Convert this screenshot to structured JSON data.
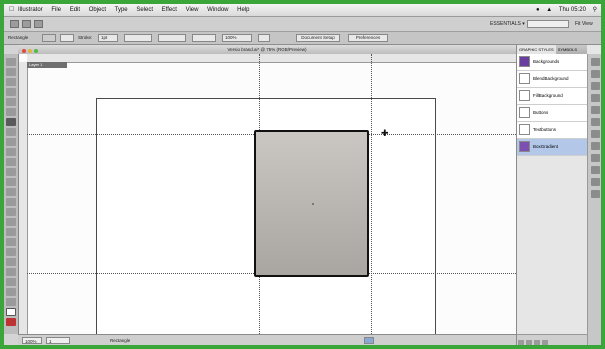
{
  "menubar": {
    "apple_icon": "apple-icon",
    "items": [
      "Illustrator",
      "File",
      "Edit",
      "Object",
      "Type",
      "Select",
      "Effect",
      "View",
      "Window",
      "Help"
    ],
    "clock": "Thu 05:20"
  },
  "appbar": {
    "workspace": "ESSENTIALS ▾",
    "zoom": "Fit View"
  },
  "controlbar": {
    "mode": "Rectangle",
    "stroke": "Stroke:",
    "stroke_value": "1pt",
    "opacity": "100%",
    "document_setup": "Document Setup",
    "preferences": "Preferences"
  },
  "document": {
    "tab_title": "Versio brand.ai* @ 75% (RGB/Preview)",
    "layer": "Layer 1"
  },
  "statusbar": {
    "zoom": "100%",
    "page": "1",
    "tool": "Rectangle"
  },
  "panel": {
    "tabs": [
      "GRAPHIC STYLES",
      "SYMBOLS"
    ],
    "styles": [
      {
        "label": "Backgrounds",
        "color": "#6a3da1"
      },
      {
        "label": "BlendBackground",
        "color": "#ffffff"
      },
      {
        "label": "FillBackground",
        "color": "#ffffff"
      },
      {
        "label": "Buttons",
        "color": "#ffffff"
      },
      {
        "label": "Textbuttons",
        "color": "#ffffff"
      },
      {
        "label": "BoxGradient",
        "color": "#7c4fb0"
      }
    ],
    "selected_index": 5
  },
  "colors": {
    "desktop": "#3aa63a",
    "rect_fill_top": "#cac7c3",
    "rect_fill_bottom": "#a9a5a1",
    "selection": "#b3c7e8"
  }
}
